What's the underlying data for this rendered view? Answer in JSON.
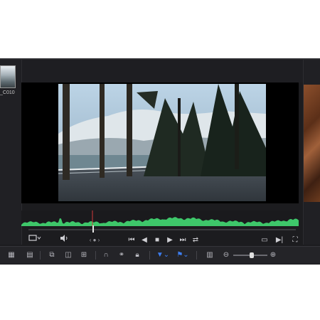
{
  "clip": {
    "thumbnail_label": "_C010"
  },
  "transport": {
    "view_icon": "monitor-icon",
    "volume_icon": "speaker-icon",
    "jog_icon": "jog-dial-icon",
    "controls": [
      "skip-to-start-icon",
      "step-back-icon",
      "stop-icon",
      "play-icon",
      "skip-to-end-icon",
      "loop-icon"
    ],
    "right_controls": [
      "safe-area-icon",
      "out-point-icon",
      "fullscreen-icon"
    ],
    "playhead_fraction": 0.24
  },
  "toolbar": {
    "tools": [
      "clip-view-icon",
      "timeline-view-icon",
      "scene-icon",
      "overwrite-icon",
      "replace-icon",
      "snap-icon",
      "link-icon",
      "lock-icon",
      "marker-icon",
      "flag-icon",
      "filmstrip-icon"
    ],
    "zoom_level_fraction": 0.55
  },
  "colors": {
    "waveform": "#3ec76a",
    "accent": "#3d7ef0",
    "playhead": "#d23b3b"
  }
}
